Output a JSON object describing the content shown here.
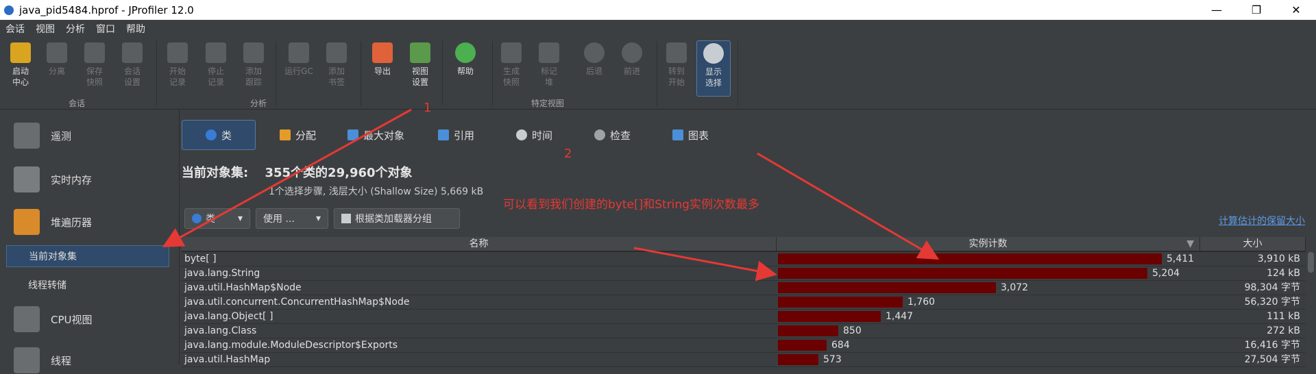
{
  "window": {
    "title": "java_pid5484.hprof - JProfiler 12.0",
    "minimize": "—",
    "maximize": "❐",
    "close": "✕"
  },
  "menu": [
    "会话",
    "视图",
    "分析",
    "窗口",
    "帮助"
  ],
  "toolbar": {
    "buttons": [
      {
        "label": "启动\n中心"
      },
      {
        "label": "分离"
      },
      {
        "label": "保存\n快照"
      },
      {
        "label": "会话\n设置"
      },
      {
        "label": "开始\n记录"
      },
      {
        "label": "停止\n记录"
      },
      {
        "label": "添加\n跟踪"
      },
      {
        "label": "运行GC"
      },
      {
        "label": "添加\n书签"
      },
      {
        "label": "导出"
      },
      {
        "label": "视图\n设置"
      },
      {
        "label": "帮助"
      },
      {
        "label": "生成\n快照"
      },
      {
        "label": "标记\n堆"
      },
      {
        "label": "后退"
      },
      {
        "label": "前进"
      },
      {
        "label": "转到\n开始"
      },
      {
        "label": "显示\n选择"
      }
    ],
    "groups": [
      "会话",
      "分析",
      "特定视图"
    ]
  },
  "sidebar": {
    "items": [
      "遥测",
      "实时内存",
      "堆遍历器",
      "CPU视图",
      "线程"
    ],
    "subitems": [
      "当前对象集",
      "线程转储"
    ]
  },
  "tabs": [
    "类",
    "分配",
    "最大对象",
    "引用",
    "时间",
    "检查",
    "图表"
  ],
  "heading": {
    "label": "当前对象集:",
    "value": "355个类的29,960个对象"
  },
  "subheading": "1个选择步骤, 浅层大小 (Shallow Size) 5,669 kB",
  "annotations": {
    "one": "1",
    "two": "2",
    "note": "可以看到我们创建的byte[]和String实例次数最多"
  },
  "filter": {
    "class_select": "类",
    "use_button": "使用 ...",
    "group_button": "根据类加载器分组",
    "retained_link": "计算估计的保留大小"
  },
  "table": {
    "columns": [
      "名称",
      "实例计数",
      "大小"
    ],
    "rows": [
      {
        "name": "byte[ ]",
        "count": "5,411",
        "count_value": 5411,
        "size": "3,910 kB"
      },
      {
        "name": "java.lang.String",
        "count": "5,204",
        "count_value": 5204,
        "size": "124 kB"
      },
      {
        "name": "java.util.HashMap$Node",
        "count": "3,072",
        "count_value": 3072,
        "size": "98,304 字节"
      },
      {
        "name": "java.util.concurrent.ConcurrentHashMap$Node",
        "count": "1,760",
        "count_value": 1760,
        "size": "56,320 字节"
      },
      {
        "name": "java.lang.Object[ ]",
        "count": "1,447",
        "count_value": 1447,
        "size": "111 kB"
      },
      {
        "name": "java.lang.Class",
        "count": "850",
        "count_value": 850,
        "size": "272 kB"
      },
      {
        "name": "java.lang.module.ModuleDescriptor$Exports",
        "count": "684",
        "count_value": 684,
        "size": "16,416 字节"
      },
      {
        "name": "java.util.HashMap",
        "count": "573",
        "count_value": 573,
        "size": "27,504 字节"
      }
    ]
  },
  "colors": {
    "bar": "#6b0000",
    "annotation": "#e53935",
    "selection": "#2f4a6a",
    "link": "#5b9be8"
  }
}
